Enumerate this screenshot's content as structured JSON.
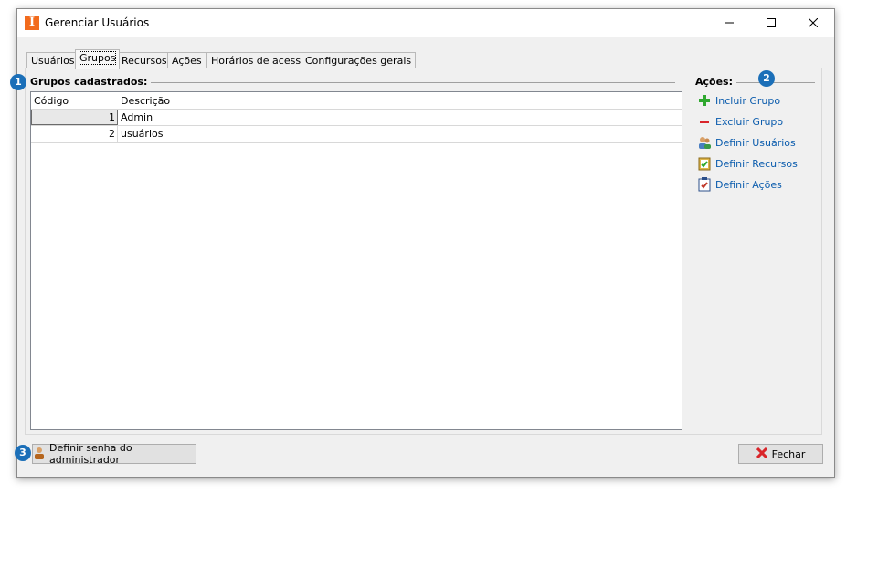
{
  "window": {
    "title": "Gerenciar Usuários",
    "icon": "app-logo-icon"
  },
  "tabs": [
    {
      "label": "Usuários",
      "active": false
    },
    {
      "label": "Grupos",
      "active": true
    },
    {
      "label": "Recursos",
      "active": false
    },
    {
      "label": "Ações",
      "active": false
    },
    {
      "label": "Horários de acesso",
      "active": false
    },
    {
      "label": "Configurações gerais",
      "active": false
    }
  ],
  "groups_section": {
    "title": "Grupos cadastrados:",
    "columns": [
      "Código",
      "Descrição"
    ],
    "rows": [
      {
        "code": "1",
        "description": "Admin"
      },
      {
        "code": "2",
        "description": "usuários"
      }
    ]
  },
  "actions_section": {
    "title": "Ações:",
    "items": [
      {
        "label": "Incluir Grupo",
        "icon": "plus-icon"
      },
      {
        "label": "Excluir Grupo",
        "icon": "minus-icon"
      },
      {
        "label": "Definir Usuários",
        "icon": "users-icon"
      },
      {
        "label": "Definir Recursos",
        "icon": "clipboard-check-icon"
      },
      {
        "label": "Definir Ações",
        "icon": "clipboard-icon"
      }
    ]
  },
  "footer": {
    "admin_password_label": "Definir senha do administrador",
    "close_label": "Fechar"
  },
  "badges": [
    "1",
    "2",
    "3"
  ],
  "colors": {
    "accent": "#1b6fb8",
    "link": "#0b5cad",
    "app_icon": "#f26b1d"
  }
}
